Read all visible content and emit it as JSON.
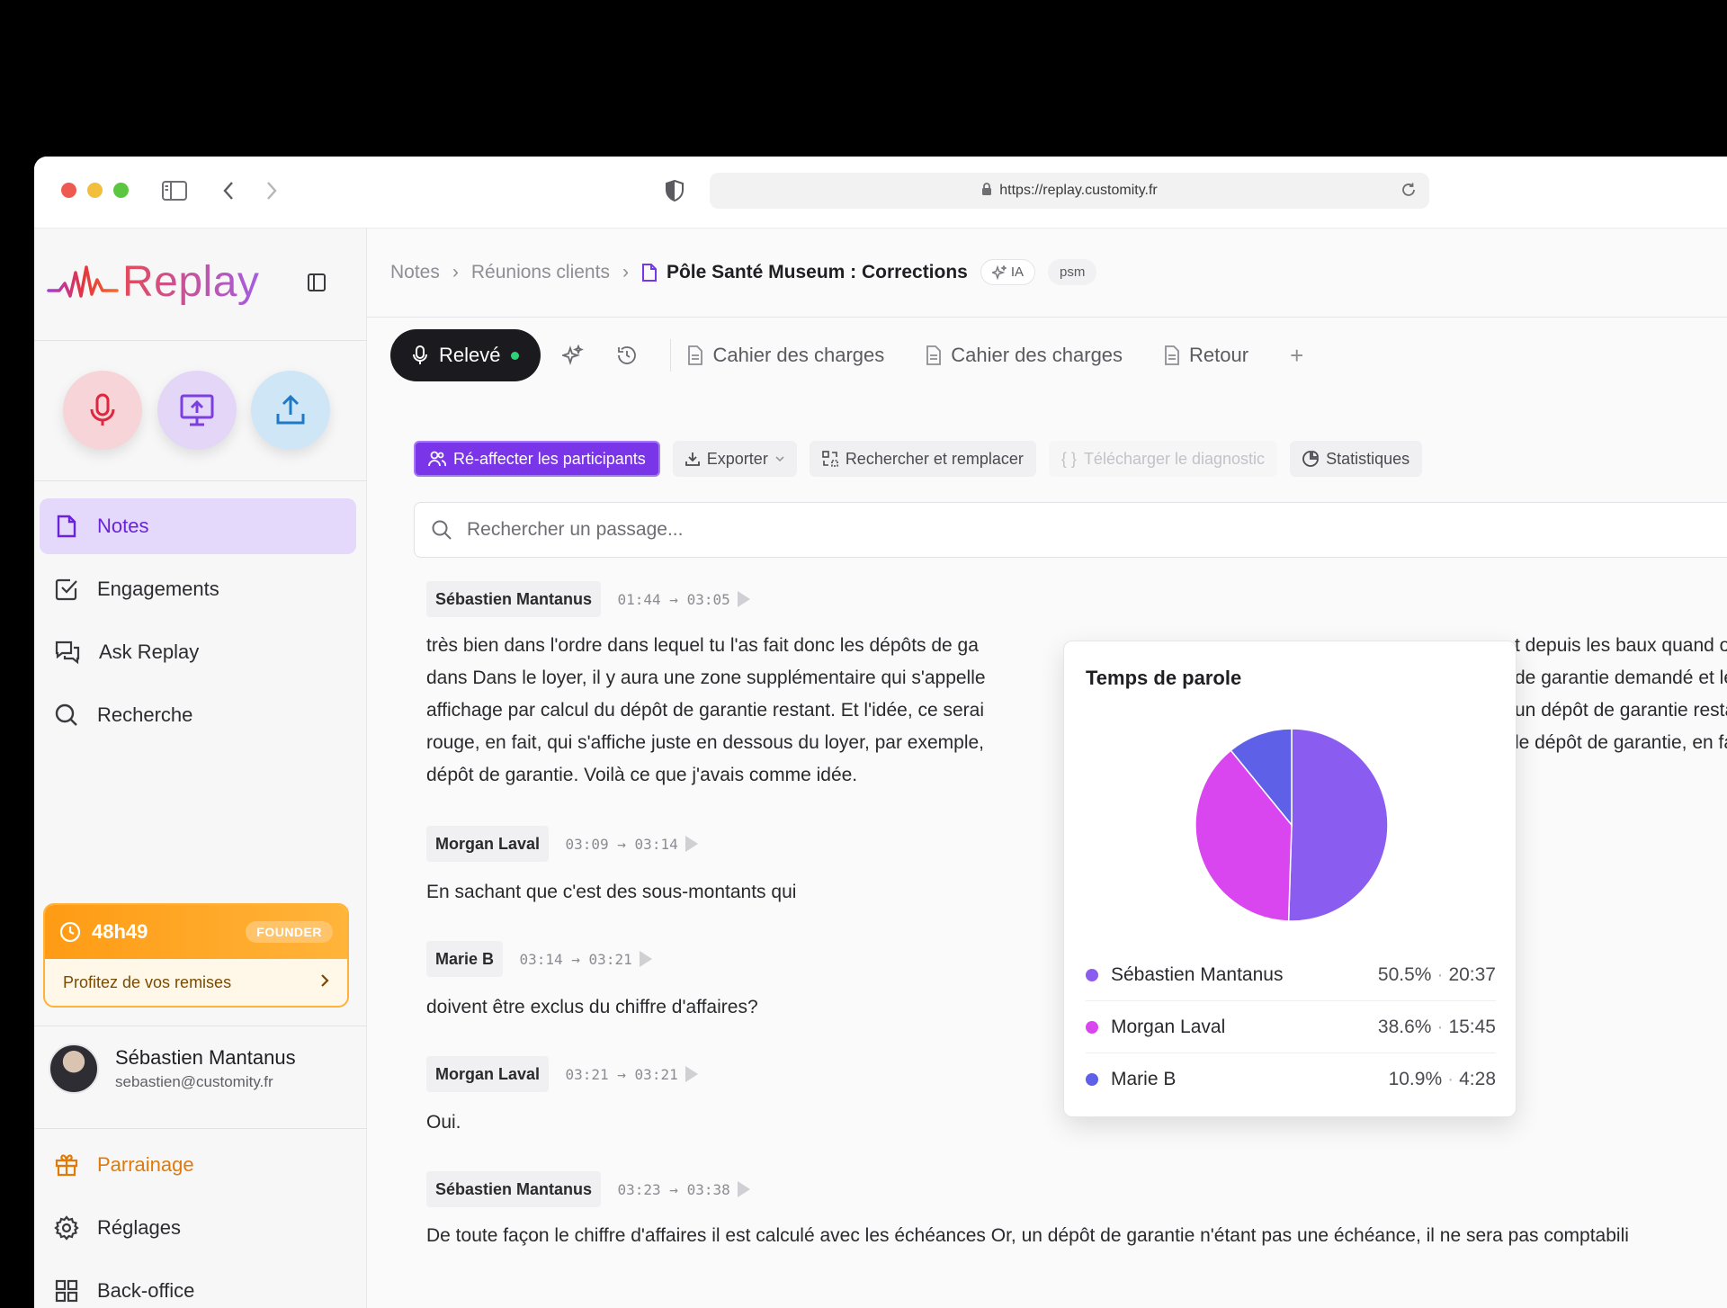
{
  "browser": {
    "url": "https://replay.customity.fr"
  },
  "sidebar": {
    "logo": "Replay",
    "nav": [
      {
        "label": "Notes"
      },
      {
        "label": "Engagements"
      },
      {
        "label": "Ask Replay"
      },
      {
        "label": "Recherche"
      }
    ],
    "promo": {
      "time": "48h49",
      "badge": "FOUNDER",
      "cta": "Profitez de vos remises"
    },
    "user": {
      "name": "Sébastien Mantanus",
      "email": "sebastien@customity.fr"
    },
    "bottom_nav": [
      {
        "label": "Parrainage"
      },
      {
        "label": "Réglages"
      },
      {
        "label": "Back-office"
      }
    ]
  },
  "breadcrumb": {
    "items": [
      "Notes",
      "Réunions clients"
    ],
    "current": "Pôle Santé Museum : Corrections",
    "chip_ia": "IA",
    "chip_tag": "psm"
  },
  "tabs": {
    "active": "Relevé",
    "docs": [
      "Cahier des charges",
      "Cahier des charges",
      "Retour"
    ],
    "add": "+"
  },
  "toolbar": {
    "reassign": "Ré-affecter les participants",
    "export": "Exporter",
    "replace": "Rechercher et remplacer",
    "diagnostic": "Télécharger le diagnostic",
    "stats": "Statistiques"
  },
  "search": {
    "placeholder": "Rechercher un passage..."
  },
  "transcript": [
    {
      "speaker": "Sébastien Mantanus",
      "time": "01:44 → 03:05",
      "lines": [
        "très bien dans l'ordre dans lequel tu l'as fait donc les dépôts de ga",
        "dans Dans le loyer, il y aura une zone supplémentaire qui s'appelle",
        "affichage par calcul du dépôt de garantie restant. Et l'idée, ce serai",
        "rouge, en fait, qui s'affiche juste en dessous du loyer, par exemple,",
        "dépôt de garantie. Voilà ce que j'avais comme idée."
      ],
      "lines_right": [
        "t depuis les baux quand on",
        "de garantie demandé et le",
        "un dépôt de garantie restan",
        "le dépôt de garantie, en fait"
      ]
    },
    {
      "speaker": "Morgan Laval",
      "time": "03:09 → 03:14",
      "text": "En sachant que c'est des sous-montants qui"
    },
    {
      "speaker": "Marie B",
      "time": "03:14 → 03:21",
      "text": "doivent être exclus du chiffre d'affaires?"
    },
    {
      "speaker": "Morgan Laval",
      "time": "03:21 → 03:21",
      "text": "Oui."
    },
    {
      "speaker": "Sébastien Mantanus",
      "time": "03:23 → 03:38",
      "text": "De toute façon le chiffre d'affaires il est calculé avec les échéances Or, un dépôt de garantie n'étant pas une échéance, il ne sera pas comptabili"
    }
  ],
  "stats_popover": {
    "title": "Temps de parole",
    "colors": {
      "Sébastien Mantanus": "#8b5cf0",
      "Morgan Laval": "#d946ef",
      "Marie B": "#5f60e8"
    },
    "rows": [
      {
        "name": "Sébastien Mantanus",
        "pct": "50.5%",
        "duration": "20:37"
      },
      {
        "name": "Morgan Laval",
        "pct": "38.6%",
        "duration": "15:45"
      },
      {
        "name": "Marie B",
        "pct": "10.9%",
        "duration": "4:28"
      }
    ]
  },
  "chart_data": {
    "type": "pie",
    "title": "Temps de parole",
    "categories": [
      "Sébastien Mantanus",
      "Morgan Laval",
      "Marie B"
    ],
    "values": [
      50.5,
      38.6,
      10.9
    ],
    "colors": [
      "#8b5cf0",
      "#d946ef",
      "#5f60e8"
    ]
  }
}
